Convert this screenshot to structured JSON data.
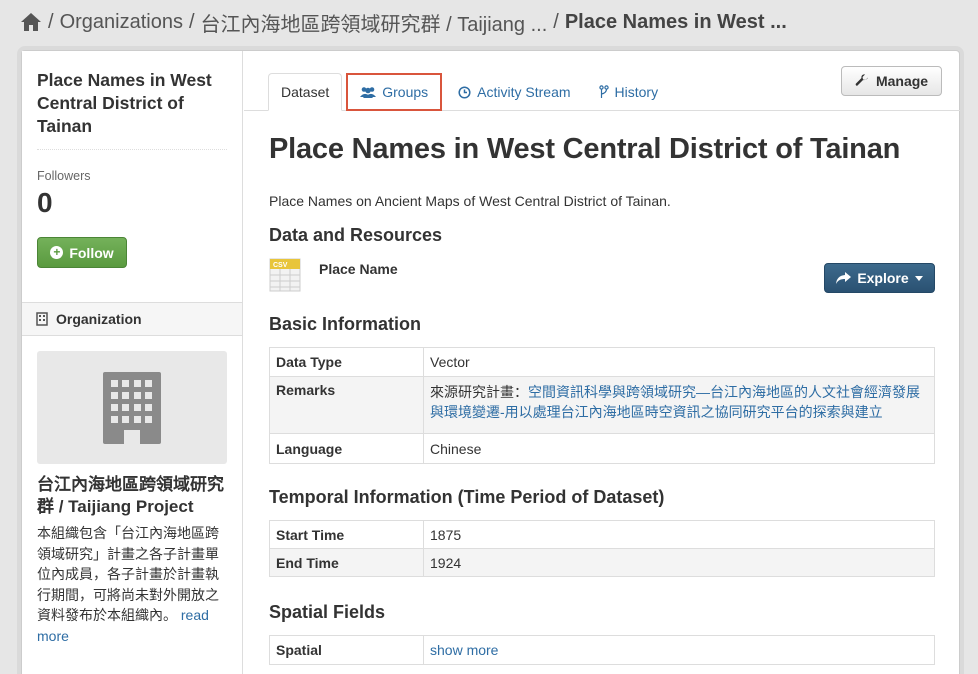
{
  "breadcrumb": {
    "items": [
      "Organizations",
      "台江內海地區跨領域研究群 / Taijiang ..."
    ],
    "current": "Place Names in West ..."
  },
  "sidebar": {
    "title": "Place Names in West Central District of Tainan",
    "followers_label": "Followers",
    "followers_count": "0",
    "follow_label": "Follow",
    "org_heading": "Organization",
    "org_name": "台江內海地區跨領域研究群 / Taijiang Project",
    "org_desc": "本組織包含「台江內海地區跨領域研究」計畫之各子計畫單位內成員，各子計畫於計畫執行期間，可將尚未對外開放之資料發布於本組織內。",
    "read_more": "read more"
  },
  "tabs": [
    {
      "label": "Dataset",
      "icon": "none"
    },
    {
      "label": "Groups",
      "icon": "users-icon"
    },
    {
      "label": "Activity Stream",
      "icon": "clock-icon"
    },
    {
      "label": "History",
      "icon": "branch-icon"
    }
  ],
  "manage_label": "Manage",
  "dataset": {
    "title": "Place Names in West Central District of Tainan",
    "description": "Place Names on Ancient Maps of West Central District of Tainan."
  },
  "resources": {
    "heading": "Data and Resources",
    "items": [
      {
        "name": "Place Name",
        "format": "CSV"
      }
    ],
    "explore_label": "Explore"
  },
  "basic_info": {
    "heading": "Basic Information",
    "rows": [
      {
        "key": "Data Type",
        "value": "Vector"
      },
      {
        "key": "Remarks",
        "prefix": "來源研究計畫：",
        "link": "空間資訊科學與跨領域研究—台江內海地區的人文社會經濟發展與環境變遷-用以處理台江內海地區時空資訊之協同研究平台的探索與建立"
      },
      {
        "key": "Language",
        "value": "Chinese"
      }
    ]
  },
  "temporal_info": {
    "heading": "Temporal Information (Time Period of Dataset)",
    "rows": [
      {
        "key": "Start Time",
        "value": "1875"
      },
      {
        "key": "End Time",
        "value": "1924"
      }
    ]
  },
  "spatial": {
    "heading": "Spatial Fields",
    "rows": [
      {
        "key": "Spatial",
        "link": "show more"
      }
    ]
  },
  "colors": {
    "link": "#2e6da4",
    "follow_green": "#5a9a3f",
    "explore_blue": "#2a5172",
    "tab_highlight": "#d9553c"
  }
}
